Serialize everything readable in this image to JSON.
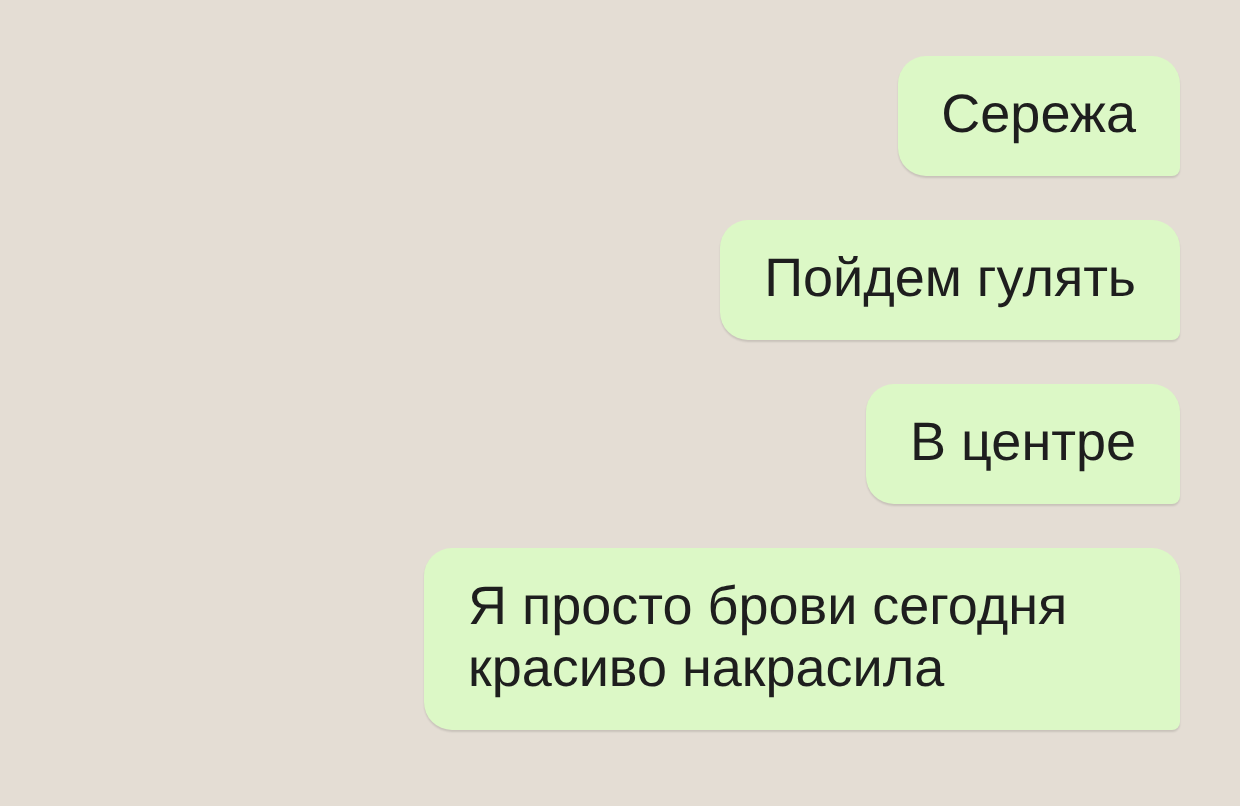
{
  "messages": [
    {
      "text": "Сережа",
      "kind": "outgoing"
    },
    {
      "text": "Пойдем гулять",
      "kind": "outgoing"
    },
    {
      "text": "В центре",
      "kind": "outgoing"
    },
    {
      "text": "Я просто брови сегодня красиво накрасила",
      "kind": "outgoing"
    }
  ]
}
